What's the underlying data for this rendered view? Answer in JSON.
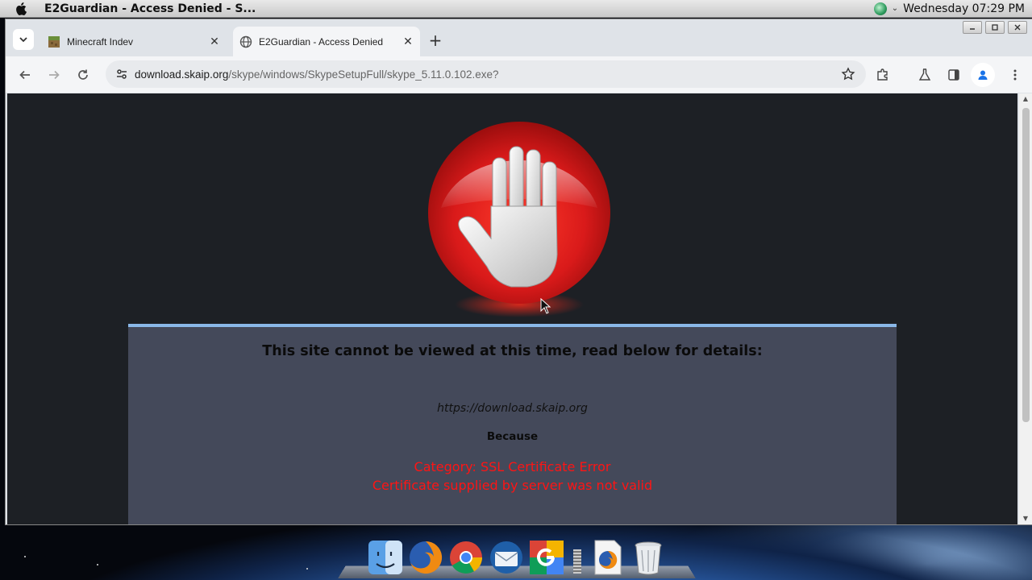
{
  "menubar": {
    "title": "E2Guardian - Access Denied - S...",
    "clock": "Wednesday 07:29 PM"
  },
  "tabs": [
    {
      "label": "Minecraft Indev",
      "active": false,
      "icon": "minecraft-block-icon"
    },
    {
      "label": "E2Guardian - Access Denied",
      "active": true,
      "icon": "globe-icon"
    }
  ],
  "toolbar": {
    "url_host": "download.skaip.org",
    "url_path": "/skype/windows/SkypeSetupFull/skype_5.11.0.102.exe?"
  },
  "page": {
    "heading": "This site cannot be viewed at this time, read below for details:",
    "blocked_url": "https://download.skaip.org",
    "because_label": "Because",
    "reason_line1": "Category: SSL Certificate Error",
    "reason_line2": "Certificate supplied by server was not valid"
  },
  "dock": {
    "items": [
      "finder-icon",
      "firefox-icon",
      "chrome-icon",
      "thunderbird-icon",
      "google-icon",
      "firefox-doc-icon",
      "trash-icon"
    ]
  },
  "colors": {
    "page_bg": "#1d2025",
    "panel_bg": "#44495a",
    "panel_border": "#8ab8e8",
    "reason_text": "#ff1414",
    "stop_red": "#d91a1a"
  }
}
